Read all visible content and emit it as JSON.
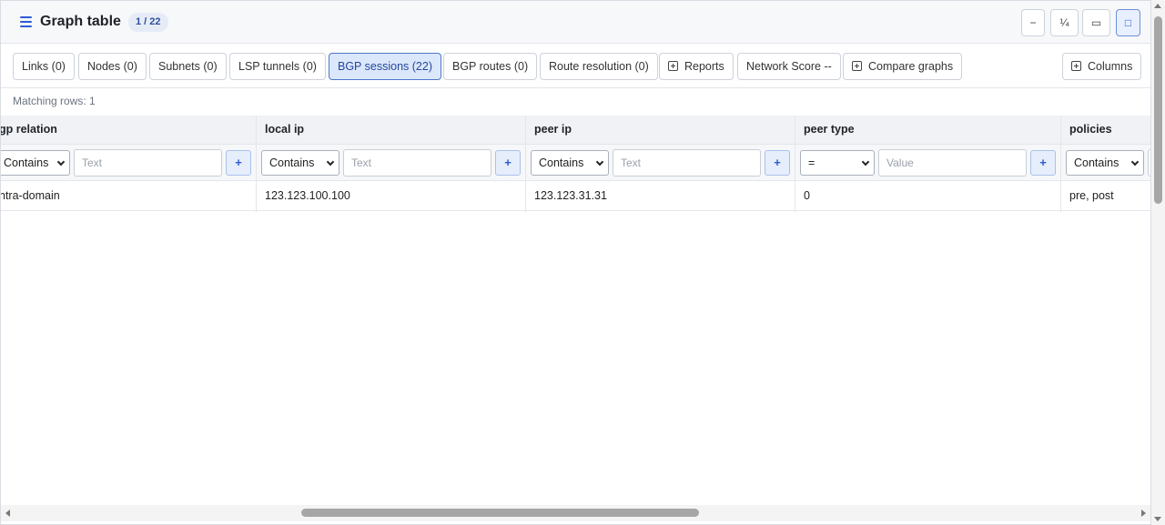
{
  "header": {
    "title": "Graph table",
    "counter": "1 / 22",
    "window_buttons": [
      "−",
      "¼",
      "▭",
      "□"
    ]
  },
  "tabs": [
    {
      "label": "Links (0)"
    },
    {
      "label": "Nodes (0)"
    },
    {
      "label": "Subnets (0)"
    },
    {
      "label": "LSP tunnels (0)"
    },
    {
      "label": "BGP sessions (22)",
      "active": true
    },
    {
      "label": "BGP routes (0)"
    },
    {
      "label": "Route resolution (0)"
    },
    {
      "label": "Reports",
      "icon": "plus-square-icon"
    },
    {
      "label": "Network Score --"
    },
    {
      "label": "Compare graphs",
      "icon": "plus-square-icon"
    }
  ],
  "columns_button": {
    "label": "Columns",
    "icon": "plus-square-icon"
  },
  "matching_rows": "Matching rows: 1",
  "table": {
    "columns": [
      {
        "header": "gp relation",
        "operator": "Contains",
        "placeholder": "Text",
        "add": "+"
      },
      {
        "header": "local ip",
        "operator": "Contains",
        "placeholder": "Text",
        "add": "+"
      },
      {
        "header": "peer ip",
        "operator": "Contains",
        "placeholder": "Text",
        "add": "+"
      },
      {
        "header": "peer type",
        "operator": "=",
        "placeholder": "Value",
        "add": "+"
      },
      {
        "header": "policies",
        "operator": "Contains"
      }
    ],
    "rows": [
      [
        "ntra-domain",
        "123.123.100.100",
        "123.123.31.31",
        "0",
        "pre, post"
      ]
    ]
  },
  "colors": {
    "accent": "#2f5bd3",
    "active_tab_bg": "#dbe7fb",
    "header_bg": "#f7f8fa"
  }
}
